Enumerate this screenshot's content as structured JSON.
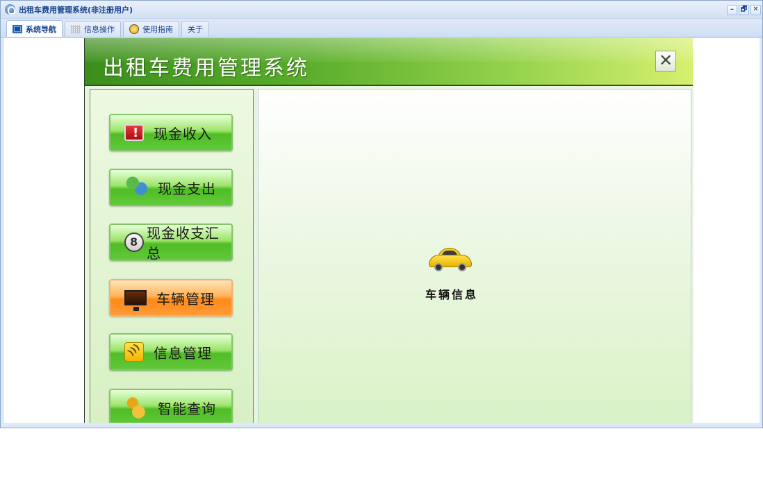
{
  "window": {
    "title": "出租车费用管理系统(非注册用户)",
    "controls": [
      "–",
      "🗗",
      "✕"
    ]
  },
  "tabs": [
    {
      "label": "系统导航",
      "icon": "monitor-icon",
      "active": true
    },
    {
      "label": "信息操作",
      "icon": "grid-icon",
      "active": false
    },
    {
      "label": "使用指南",
      "icon": "lamp-icon",
      "active": false
    },
    {
      "label": "关于",
      "icon": "",
      "active": false
    }
  ],
  "banner": {
    "title": "出租车费用管理系统",
    "close_glyph": "✕"
  },
  "menu": [
    {
      "label": "现金收入",
      "icon": "alert-icon",
      "style": "green"
    },
    {
      "label": "现金支出",
      "icon": "people-icon",
      "style": "green"
    },
    {
      "label": "现金收支汇总",
      "icon": "contact-icon",
      "style": "green"
    },
    {
      "label": "车辆管理",
      "icon": "monitor-screen-icon",
      "style": "orange"
    },
    {
      "label": "信息管理",
      "icon": "rss-icon",
      "style": "green"
    },
    {
      "label": "智能查询",
      "icon": "coins-icon",
      "style": "green"
    }
  ],
  "main": {
    "item_label": "车辆信息",
    "item_icon": "taxi-car-icon"
  },
  "colors": {
    "title_text": "#15428b",
    "banner_green": "#58ac2a",
    "button_green": "#4fbc25",
    "button_orange": "#ff8a18"
  }
}
